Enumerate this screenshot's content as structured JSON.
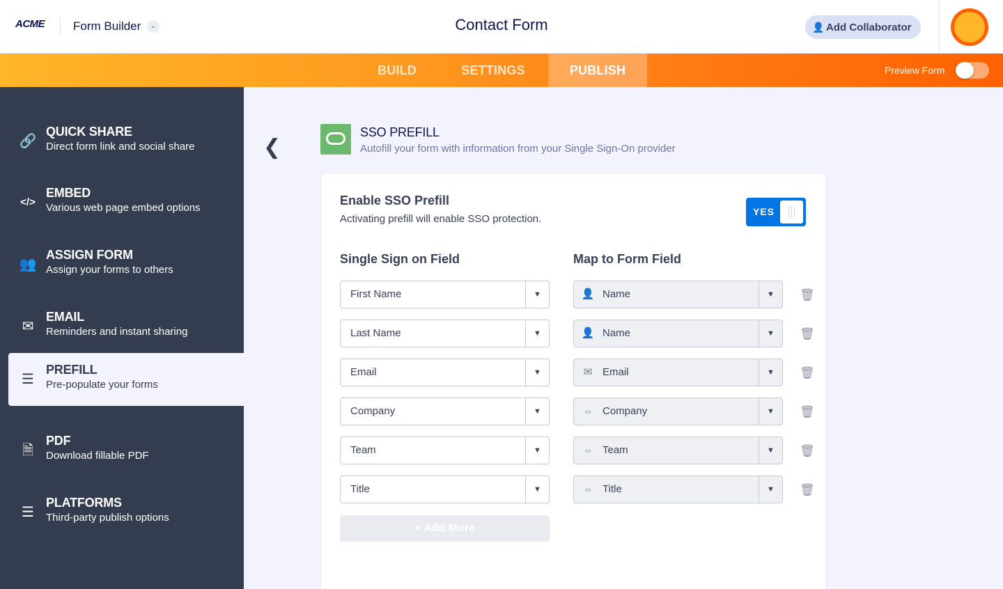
{
  "header": {
    "logo": "ACME",
    "app_title": "Form Builder",
    "form_title": "Contact Form",
    "collaborator_label": "Add Collaborator"
  },
  "tabs": [
    {
      "label": "BUILD",
      "active": false
    },
    {
      "label": "SETTINGS",
      "active": false
    },
    {
      "label": "PUBLISH",
      "active": true
    }
  ],
  "preview": {
    "label": "Preview Form",
    "enabled": false
  },
  "sidebar": {
    "items": [
      {
        "title": "QUICK SHARE",
        "subtitle": "Direct form link and social share",
        "icon": "link-icon"
      },
      {
        "title": "EMBED",
        "subtitle": "Various web page embed options",
        "icon": "code-icon"
      },
      {
        "title": "ASSIGN FORM",
        "subtitle": "Assign your forms to others",
        "icon": "users-icon"
      },
      {
        "title": "EMAIL",
        "subtitle": "Reminders and instant sharing",
        "icon": "envelope-icon"
      },
      {
        "title": "PREFILL",
        "subtitle": "Pre-populate your forms",
        "icon": "prefill-icon",
        "active": true
      },
      {
        "title": "PDF",
        "subtitle": "Download fillable PDF",
        "icon": "pdf-icon"
      },
      {
        "title": "PLATFORMS",
        "subtitle": "Third-party publish options",
        "icon": "layers-icon"
      }
    ]
  },
  "sso": {
    "title": "SSO PREFILL",
    "subtitle": "Autofill your form with information from your Single Sign-On provider",
    "icon_color": "#6cb86c"
  },
  "enable": {
    "title": "Enable SSO Prefill",
    "subtitle": "Activating prefill will enable SSO protection.",
    "toggle_label": "YES",
    "enabled": true
  },
  "columns": {
    "sso_field": "Single Sign on Field",
    "form_field": "Map to Form Field"
  },
  "mappings": [
    {
      "sso": "First Name",
      "field": "Name",
      "field_icon": "user-circle-icon"
    },
    {
      "sso": "Last Name",
      "field": "Name",
      "field_icon": "user-circle-icon"
    },
    {
      "sso": "Email",
      "field": "Email",
      "field_icon": "envelope-icon"
    },
    {
      "sso": "Company",
      "field": "Company",
      "field_icon": "textbox-icon"
    },
    {
      "sso": "Team",
      "field": "Team",
      "field_icon": "textbox-icon"
    },
    {
      "sso": "Title",
      "field": "Title",
      "field_icon": "textbox-icon"
    }
  ],
  "add_more_label": "+ Add More",
  "colors": {
    "accent_orange": "#ff6100",
    "sidebar_bg": "#343c4f",
    "toggle_blue": "#0075e3"
  }
}
